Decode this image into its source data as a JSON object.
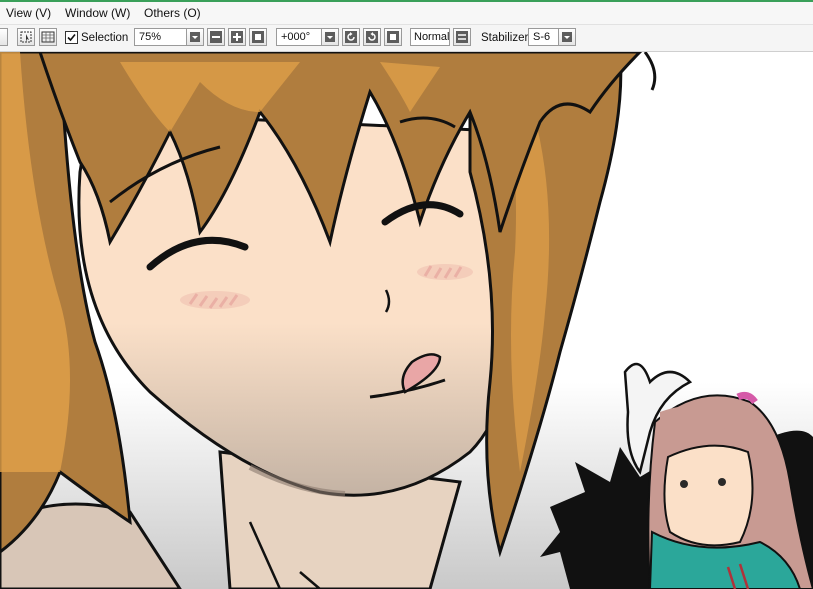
{
  "menu": {
    "items": [
      {
        "label": "View (V)"
      },
      {
        "label": "Window (W)"
      },
      {
        "label": "Others (O)"
      }
    ]
  },
  "toolbar": {
    "selection_label": "Selection",
    "selection_checked": true,
    "zoom_value": "75%",
    "rotation_value": "+000°",
    "blend_mode": "Normal",
    "stabilizer_label": "Stabilizer",
    "stabilizer_value": "S-6"
  },
  "canvas": {
    "description_icon": "anime-illustration",
    "colors": {
      "hair": "#b07d3e",
      "hair_light": "#e2a14a",
      "skin": "#fbe0c8",
      "skin_shadow": "#dcc6b0",
      "blush": "#e8a9a0",
      "tongue": "#e9a6a6",
      "jacket": "#2ba79a",
      "hair_pink": "#c89a92"
    }
  }
}
